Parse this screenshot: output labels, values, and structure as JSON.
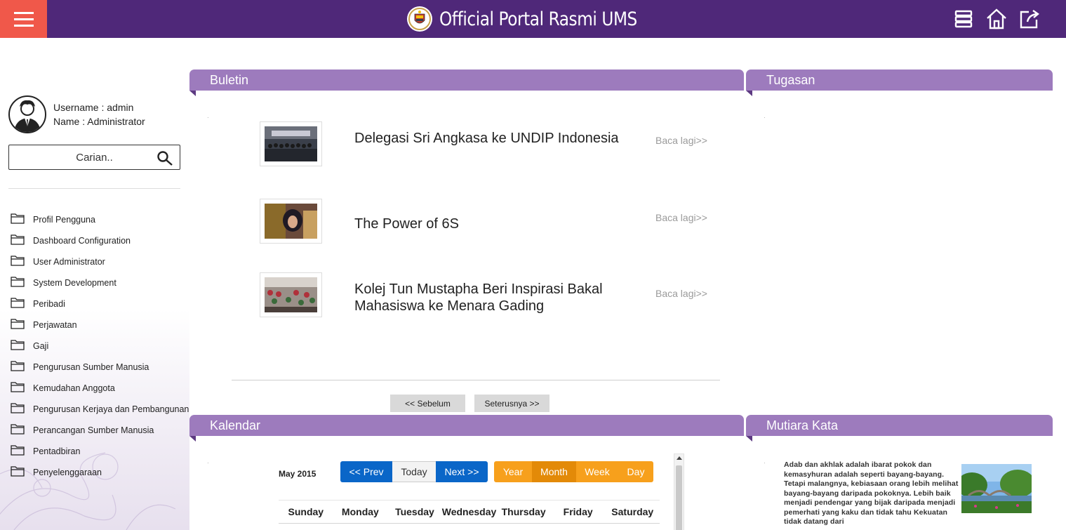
{
  "header": {
    "title": "Official Portal Rasmi UMS",
    "icons": [
      "menu-icon",
      "server-icon",
      "home-icon",
      "share-icon"
    ]
  },
  "user": {
    "username_line": "Username : admin",
    "name_line": "Name : Administrator"
  },
  "search": {
    "placeholder": "Carian.."
  },
  "sidebar": {
    "items": [
      {
        "label": "Profil Pengguna"
      },
      {
        "label": "Dashboard Configuration"
      },
      {
        "label": "User Administrator"
      },
      {
        "label": "System Development"
      },
      {
        "label": "Peribadi"
      },
      {
        "label": "Perjawatan"
      },
      {
        "label": "Gaji"
      },
      {
        "label": "Pengurusan Sumber Manusia"
      },
      {
        "label": "Kemudahan Anggota"
      },
      {
        "label": "Pengurusan Kerjaya dan Pembangunan"
      },
      {
        "label": "Perancangan Sumber Manusia"
      },
      {
        "label": "Pentadbiran"
      },
      {
        "label": "Penyelenggaraan"
      }
    ]
  },
  "buletin": {
    "title": "Buletin",
    "items": [
      {
        "title": "Delegasi Sri Angkasa ke UNDIP Indonesia",
        "more": "Baca lagi>>"
      },
      {
        "title": "The Power of 6S",
        "more": "Baca lagi>>"
      },
      {
        "title": "Kolej Tun Mustapha Beri Inspirasi Bakal Mahasiswa ke Menara Gading",
        "more": "Baca lagi>>"
      }
    ],
    "prev_label": "<< Sebelum",
    "next_label": "Seterusnya >>"
  },
  "tugasan": {
    "title": "Tugasan"
  },
  "kalendar": {
    "title": "Kalendar",
    "month_label": "May 2015",
    "nav": {
      "prev": "<< Prev",
      "today": "Today",
      "next": "Next >>"
    },
    "views": {
      "year": "Year",
      "month": "Month",
      "week": "Week",
      "day": "Day"
    },
    "selected_view": "Month",
    "weekdays": [
      "Sunday",
      "Monday",
      "Tuesday",
      "Wednesday",
      "Thursday",
      "Friday",
      "Saturday"
    ]
  },
  "mutiara": {
    "title": "Mutiara Kata",
    "quote": "Adab dan akhlak adalah ibarat pokok dan kemasyhuran adalah seperti bayang-bayang. Tetapi malangnya, kebiasaan orang lebih melihat bayang-bayang daripada pokoknya. Lebih baik menjadi pendengar yang bijak daripada menjadi pemerhati yang kaku dan tidak tahu Kekuatan tidak datang dari"
  },
  "colors": {
    "topbar": "#4f2879",
    "menu_button": "#f0584a",
    "panel_header": "#9d7bbd",
    "blue_button": "#0a66c8",
    "orange_button": "#f7a01c"
  }
}
